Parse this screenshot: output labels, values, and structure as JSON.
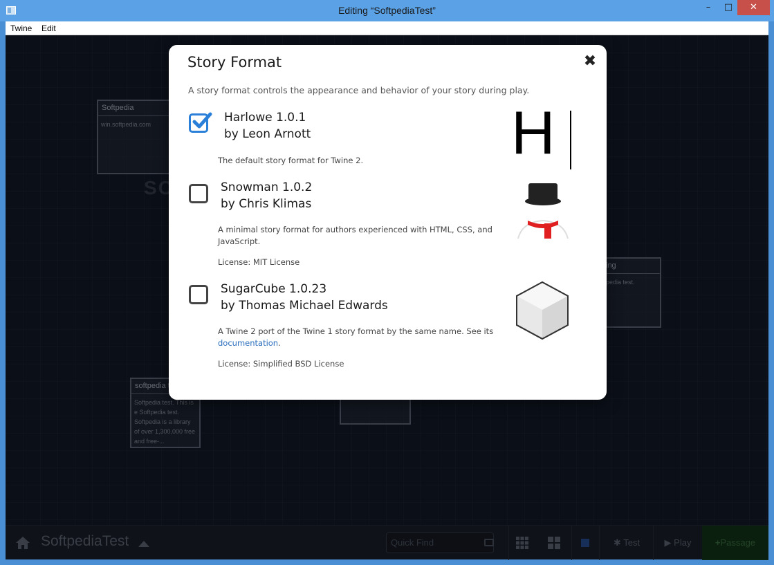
{
  "window": {
    "title": "Editing “SoftpediaTest”",
    "minimize_glyph": "–",
    "maximize_glyph": "□",
    "close_glyph": "✕"
  },
  "menubar": {
    "items": [
      {
        "label": "Twine"
      },
      {
        "label": "Edit"
      }
    ]
  },
  "background": {
    "watermark": "SOFTPEDIA",
    "passages": [
      {
        "title": "Softpedia",
        "body": "win.softpedia.com"
      },
      {
        "title": "softpedia t",
        "body": "Softpedia test. This is\ne Softpedia test.\nSoftpedia is a library\nof over 1,300,000 free\nand free-..."
      },
      {
        "title": "ing",
        "body": "pedia test."
      },
      {
        "title": "",
        "body": ""
      }
    ]
  },
  "dialog": {
    "title": "Story Format",
    "close_glyph": "✖",
    "intro": "A story format controls the appearance and behavior of your story during play.",
    "formats": [
      {
        "name": "Harlowe 1.0.1",
        "author": "by Leon Arnott",
        "description": "The default story format for Twine 2.",
        "checked": true,
        "logo": "H",
        "logo_icon": "harlowe-logo"
      },
      {
        "name": "Snowman 1.0.2",
        "author": "by Chris Klimas",
        "description": "A minimal story format for authors experienced with HTML, CSS, and JavaScript.",
        "license": "License: MIT License",
        "checked": false,
        "logo_icon": "snowman-logo"
      },
      {
        "name": "SugarCube 1.0.23",
        "author": "by Thomas Michael Edwards",
        "description_prefix": "A Twine 2 port of the Twine 1 story format by the same name. See its",
        "description_link": "documentation",
        "description_suffix": ".",
        "license": "License: Simplified BSD License",
        "checked": false,
        "logo_icon": "sugarcube-logo"
      }
    ]
  },
  "toolbar": {
    "story_name": "SoftpediaTest",
    "quick_find_placeholder": "Quick Find",
    "test_label": "Test",
    "play_label": "Play",
    "passage_label": "Passage"
  },
  "colors": {
    "checkbox_checked": "#2a7fd8",
    "link": "#2a6ebd",
    "titlebar": "#5aa1e6",
    "close_button": "#c7504a"
  }
}
